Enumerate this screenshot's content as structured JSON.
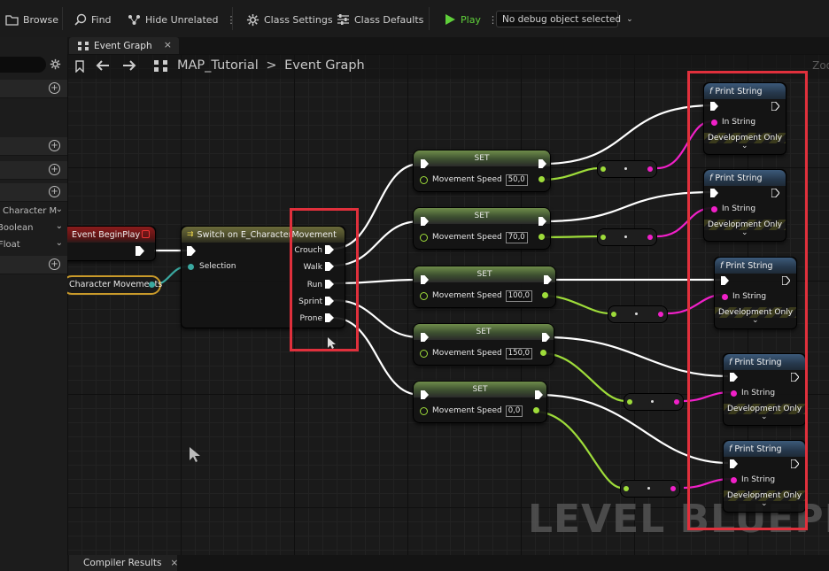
{
  "toolbar": {
    "browse_label": "Browse",
    "find_label": "Find",
    "hide_unrelated_label": "Hide Unrelated",
    "class_settings_label": "Class Settings",
    "class_defaults_label": "Class Defaults",
    "play_label": "Play",
    "debug_selector_value": "No debug object selected"
  },
  "tabs": {
    "event_graph_label": "Event Graph",
    "close_glyph": "×"
  },
  "breadcrumb": {
    "map_name": "MAP_Tutorial",
    "separator": ">",
    "graph_name": "Event Graph",
    "zoom_partial": "Zoo"
  },
  "left_panel": {
    "rows": [
      "Character M",
      "Boolean",
      "Float"
    ]
  },
  "nodes": {
    "event_begin_play": {
      "title": "Event BeginPlay"
    },
    "variable_get": {
      "label": "Character Movements"
    },
    "switch": {
      "title": "Switch on E_CharacterMovement",
      "selection_label": "Selection",
      "outputs": [
        "Crouch",
        "Walk",
        "Run",
        "Sprint",
        "Prone"
      ]
    },
    "set_nodes": [
      {
        "title": "SET",
        "pin_label": "Movement Speed",
        "value": "50,0"
      },
      {
        "title": "SET",
        "pin_label": "Movement Speed",
        "value": "70,0"
      },
      {
        "title": "SET",
        "pin_label": "Movement Speed",
        "value": "100,0"
      },
      {
        "title": "SET",
        "pin_label": "Movement Speed",
        "value": "150,0"
      },
      {
        "title": "SET",
        "pin_label": "Movement Speed",
        "value": "0,0"
      }
    ],
    "print_strings": [
      {
        "title": "Print String",
        "in_label": "In String",
        "footer": "Development Only"
      },
      {
        "title": "Print String",
        "in_label": "In String",
        "footer": "Development Only"
      },
      {
        "title": "Print String",
        "in_label": "In String",
        "footer": "Development Only"
      },
      {
        "title": "Print String",
        "in_label": "In String",
        "footer": "Development Only"
      },
      {
        "title": "Print String",
        "in_label": "In String",
        "footer": "Development Only"
      }
    ]
  },
  "watermark": "LEVEL BLUEPRIN",
  "bottom": {
    "compiler_results_label": "Compiler Results",
    "close_glyph": "×"
  },
  "colors": {
    "highlight_red": "#e0303c",
    "exec_white": "#ffffff",
    "float_green": "#9edc3a",
    "string_pink": "#f020c8",
    "enum_teal": "#3aa8a0",
    "play_green": "#5fcf3a"
  }
}
